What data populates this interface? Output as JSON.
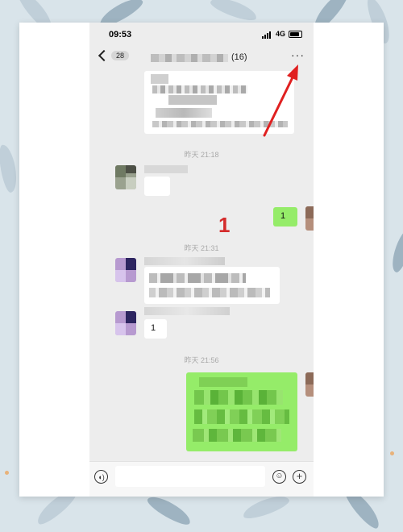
{
  "status_bar": {
    "time": "09:53",
    "network": "4G"
  },
  "nav": {
    "back_badge": "28",
    "member_count": "(16)",
    "more_icon": "···"
  },
  "timestamps": [
    "昨天 21:18",
    "昨天 21:31",
    "昨天 21:56"
  ],
  "messages": {
    "sent_1": "1",
    "recv_1": "1"
  },
  "annotation": {
    "number": "1",
    "arrow_color": "#e02020"
  },
  "colors": {
    "chat_bg": "#ededed",
    "sent_bubble": "#95ec69",
    "recv_bubble": "#ffffff"
  }
}
